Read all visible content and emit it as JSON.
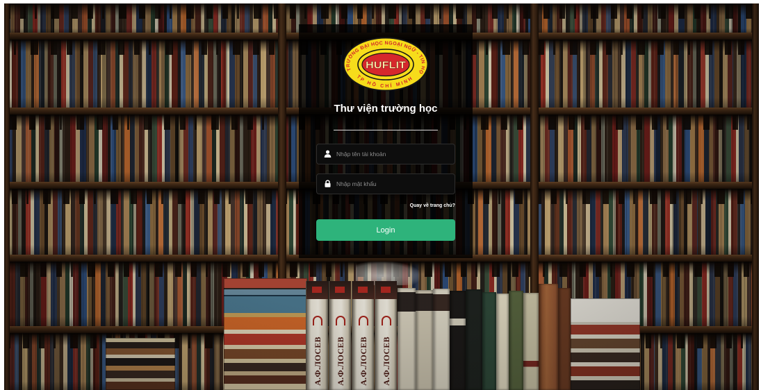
{
  "logo": {
    "name": "HUFLIT",
    "top_arc": "TRƯỜNG ĐẠI HỌC NGOẠI NGỮ - TIN HỌC",
    "bottom_arc": "TP HỒ CHÍ MINH"
  },
  "login_form": {
    "title": "Thư viện trường học",
    "username": {
      "icon": "user-icon",
      "placeholder": "Nhập tên tài khoản",
      "value": ""
    },
    "password": {
      "icon": "lock-icon",
      "placeholder": "Nhập mật khẩu",
      "value": ""
    },
    "home_link": "Quay về trang chủ?",
    "submit_label": "Login"
  },
  "background": {
    "spine_labels": [
      "А.Ф.ЛОСЕВ",
      "А.Ф.ЛОСЕВ",
      "А.Ф.ЛОСЕВ",
      "А.Ф.ЛОСЕВ"
    ]
  },
  "colors": {
    "login_button": "#2eb37b",
    "panel_background": "#000000",
    "logo_yellow": "#f6dc1b",
    "logo_red": "#d6282c"
  }
}
